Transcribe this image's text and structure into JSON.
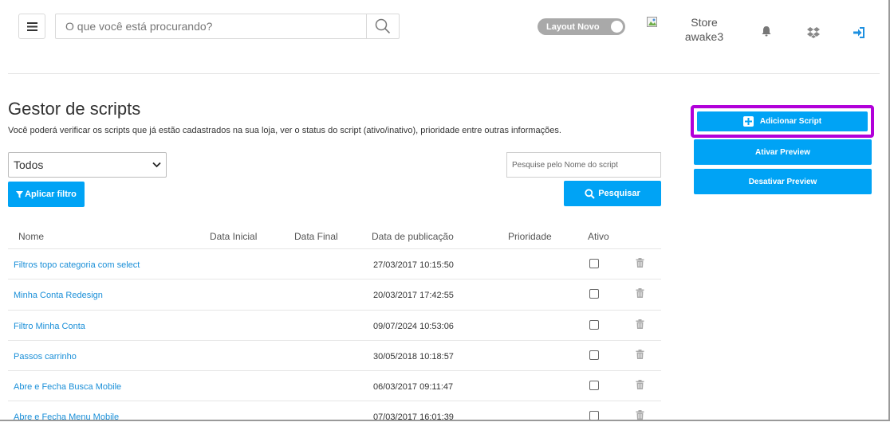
{
  "header": {
    "search_placeholder": "O que você está procurando?",
    "layout_toggle_label": "Layout Novo",
    "store_line1": "Store",
    "store_line2": "awake3"
  },
  "page": {
    "title": "Gestor de scripts",
    "description": "Você poderá verificar os scripts que já estão cadastrados na sua loja, ver o status do script (ativo/inativo), prioridade entre outras informações."
  },
  "filters": {
    "status_selected": "Todos",
    "apply_label": "Aplicar filtro",
    "name_search_placeholder": "Pesquise pelo Nome do script",
    "search_label": "Pesquisar"
  },
  "table": {
    "columns": [
      "Nome",
      "Data Inicial",
      "Data Final",
      "Data de publicação",
      "Prioridade",
      "Ativo"
    ],
    "rows": [
      {
        "name": "Filtros topo categoria com select",
        "published": "27/03/2017 10:15:50"
      },
      {
        "name": "Minha Conta Redesign",
        "published": "20/03/2017 17:42:55"
      },
      {
        "name": "Filtro Minha Conta",
        "published": "09/07/2024 10:53:06"
      },
      {
        "name": "Passos carrinho",
        "published": "30/05/2018 10:18:57"
      },
      {
        "name": "Abre e Fecha Busca Mobile",
        "published": "06/03/2017 09:11:47"
      },
      {
        "name": "Abre e Fecha Menu Mobile",
        "published": "07/03/2017 16:01:39"
      }
    ]
  },
  "actions": {
    "add_label": "Adicionar Script",
    "enable_preview_label": "Ativar Preview",
    "disable_preview_label": "Desativar Preview"
  },
  "colors": {
    "accent": "#00a3f5",
    "highlight": "#b100d9",
    "link": "#1a8fd8"
  },
  "icons": [
    "menu-icon",
    "search-icon",
    "broken-image-icon",
    "bell-icon",
    "dropbox-icon",
    "sign-in-icon",
    "filter-icon",
    "plus-square-icon",
    "trash-icon",
    "chevron-down-icon"
  ]
}
